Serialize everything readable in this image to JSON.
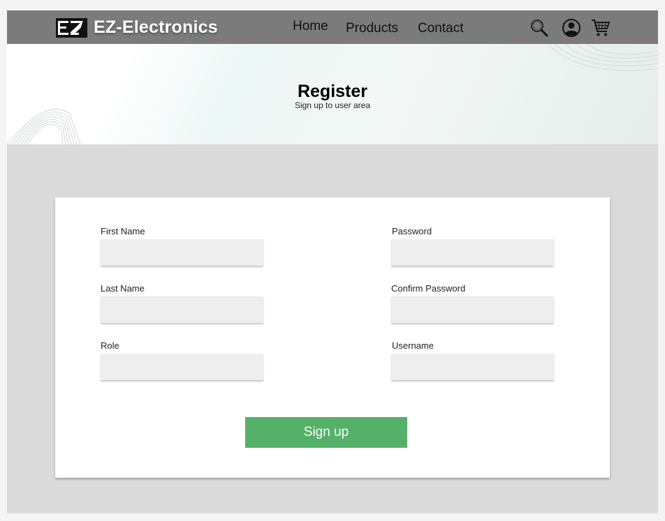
{
  "brand": {
    "name": "EZ-Electronics"
  },
  "nav": {
    "home": "Home",
    "products": "Products",
    "contact": "Contact"
  },
  "icons": {
    "search": "search-icon",
    "account": "user-icon",
    "cart": "cart-icon"
  },
  "hero": {
    "title": "Register",
    "subtitle": "Sign up to user area"
  },
  "form": {
    "first_name": {
      "label": "First Name",
      "value": ""
    },
    "last_name": {
      "label": "Last Name",
      "value": ""
    },
    "role": {
      "label": "Role",
      "value": ""
    },
    "password": {
      "label": "Password",
      "value": ""
    },
    "confirm_password": {
      "label": "Confirm Password",
      "value": ""
    },
    "username": {
      "label": "Username",
      "value": ""
    },
    "submit_label": "Sign up"
  },
  "colors": {
    "header": "#7b7b7b",
    "accent": "#55b06a",
    "background": "#dadada",
    "input": "#eeeeee"
  }
}
